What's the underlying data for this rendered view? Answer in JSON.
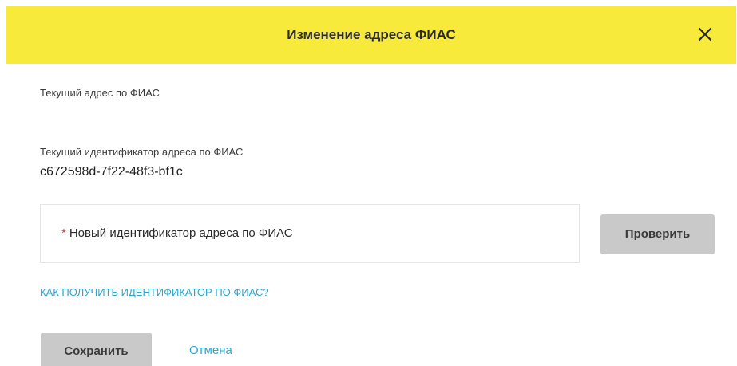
{
  "dialog": {
    "title": "Изменение адреса ФИАС",
    "close_icon": "close-icon"
  },
  "current_address": {
    "label": "Текущий адрес по ФИАС"
  },
  "current_id": {
    "label": "Текущий идентификатор адреса по ФИАС",
    "value": "c672598d-7f22-48f3-bf1c"
  },
  "new_id": {
    "required_mark": "*",
    "label": "Новый идентификатор адреса по ФИАС"
  },
  "buttons": {
    "check_label": "Проверить",
    "save_label": "Сохранить",
    "cancel_label": "Отмена"
  },
  "help": {
    "link_text": "КАК ПОЛУЧИТЬ ИДЕНТИФИКАТОР ПО ФИАС?"
  },
  "colors": {
    "header_bg": "#f7ea3a",
    "link": "#2aa6cf",
    "button_bg": "#c9c9c9",
    "required": "#e53935"
  }
}
